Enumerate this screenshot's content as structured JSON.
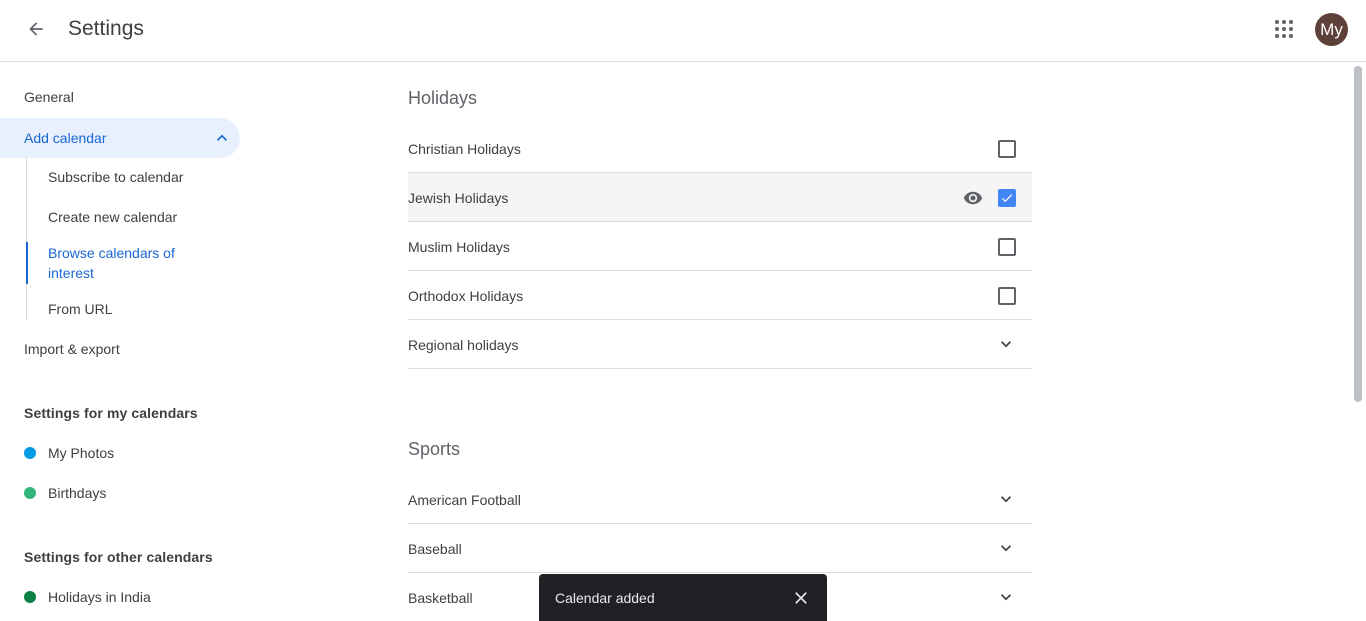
{
  "header": {
    "title": "Settings",
    "avatar_text": "My"
  },
  "sidebar": {
    "general": "General",
    "add_calendar": "Add calendar",
    "sub_items": [
      "Subscribe to calendar",
      "Create new calendar",
      "Browse calendars of interest",
      "From URL"
    ],
    "import_export": "Import & export",
    "my_calendars_heading": "Settings for my calendars",
    "my_calendars": [
      {
        "label": "My Photos",
        "color": "#039be5"
      },
      {
        "label": "Birthdays",
        "color": "#33b679"
      }
    ],
    "other_calendars_heading": "Settings for other calendars",
    "other_calendars": [
      {
        "label": "Holidays in India",
        "color": "#0b8043"
      }
    ]
  },
  "holidays": {
    "title": "Holidays",
    "rows": [
      {
        "label": "Christian Holidays",
        "checked": false
      },
      {
        "label": "Jewish Holidays",
        "checked": true
      },
      {
        "label": "Muslim Holidays",
        "checked": false
      },
      {
        "label": "Orthodox Holidays",
        "checked": false
      },
      {
        "label": "Regional holidays"
      }
    ]
  },
  "sports": {
    "title": "Sports",
    "rows": [
      "American Football",
      "Baseball",
      "Basketball"
    ]
  },
  "snackbar": {
    "message": "Calendar added"
  },
  "colors": {
    "accent": "#1967d2",
    "checkbox_checked": "#4285f4",
    "active_nav_bg": "#e8f0fe",
    "avatar_bg": "#5d4037"
  }
}
